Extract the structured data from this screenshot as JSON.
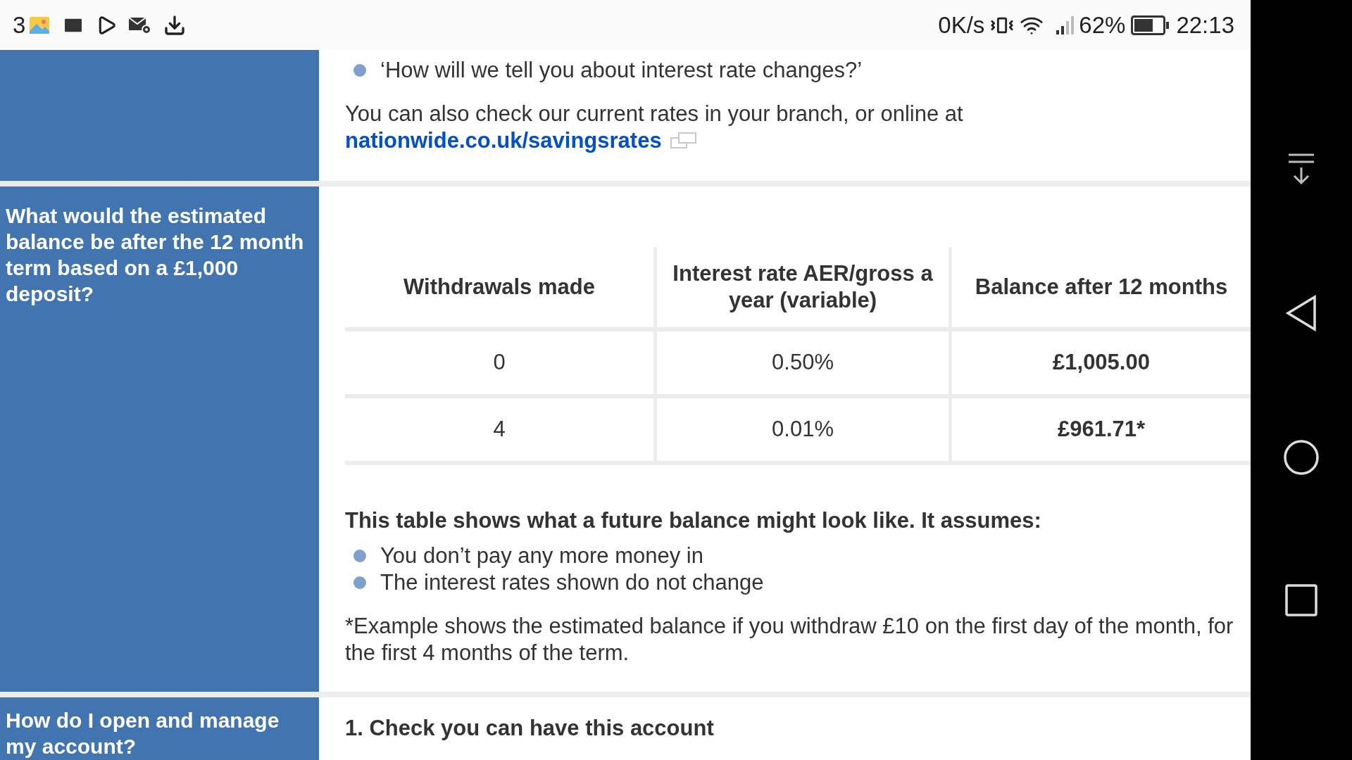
{
  "status_bar": {
    "notification_count": "3",
    "network_speed": "0K/s",
    "battery": "62%",
    "time": "22:13"
  },
  "sections": [
    {
      "blocks": [
        {
          "kind": "bullets",
          "items": [
            "‘How will we tell you about interest rate changes?’"
          ]
        },
        {
          "kind": "paragraph",
          "text": "You can also check our current rates in your branch, or online at",
          "link": "nationwide.co.uk/savingsrates"
        }
      ]
    },
    {
      "heading": "What would the estimated balance be after the 12 month term based on a £1,000 deposit?",
      "blocks": [
        {
          "kind": "table",
          "columns": [
            "Withdrawals made",
            "Interest rate AER/gross a year (variable)",
            "Balance after 12 months"
          ],
          "rows": [
            [
              "0",
              "0.50%",
              "£1,005.00"
            ],
            [
              "4",
              "0.01%",
              "£961.71*"
            ]
          ]
        },
        {
          "kind": "lead",
          "text": "This table shows what a future balance might look like. It assumes:"
        },
        {
          "kind": "bullets",
          "items": [
            "You don’t pay any more money in",
            "The interest rates shown do not change"
          ]
        },
        {
          "kind": "paragraph",
          "text": "*Example shows the estimated balance if you withdraw £10 on the first day of the month, for the first 4 months of the term."
        }
      ]
    },
    {
      "heading": "How do I open and manage my account?",
      "blocks": [
        {
          "kind": "lead",
          "text": "1. Check you can have this account"
        }
      ]
    }
  ]
}
